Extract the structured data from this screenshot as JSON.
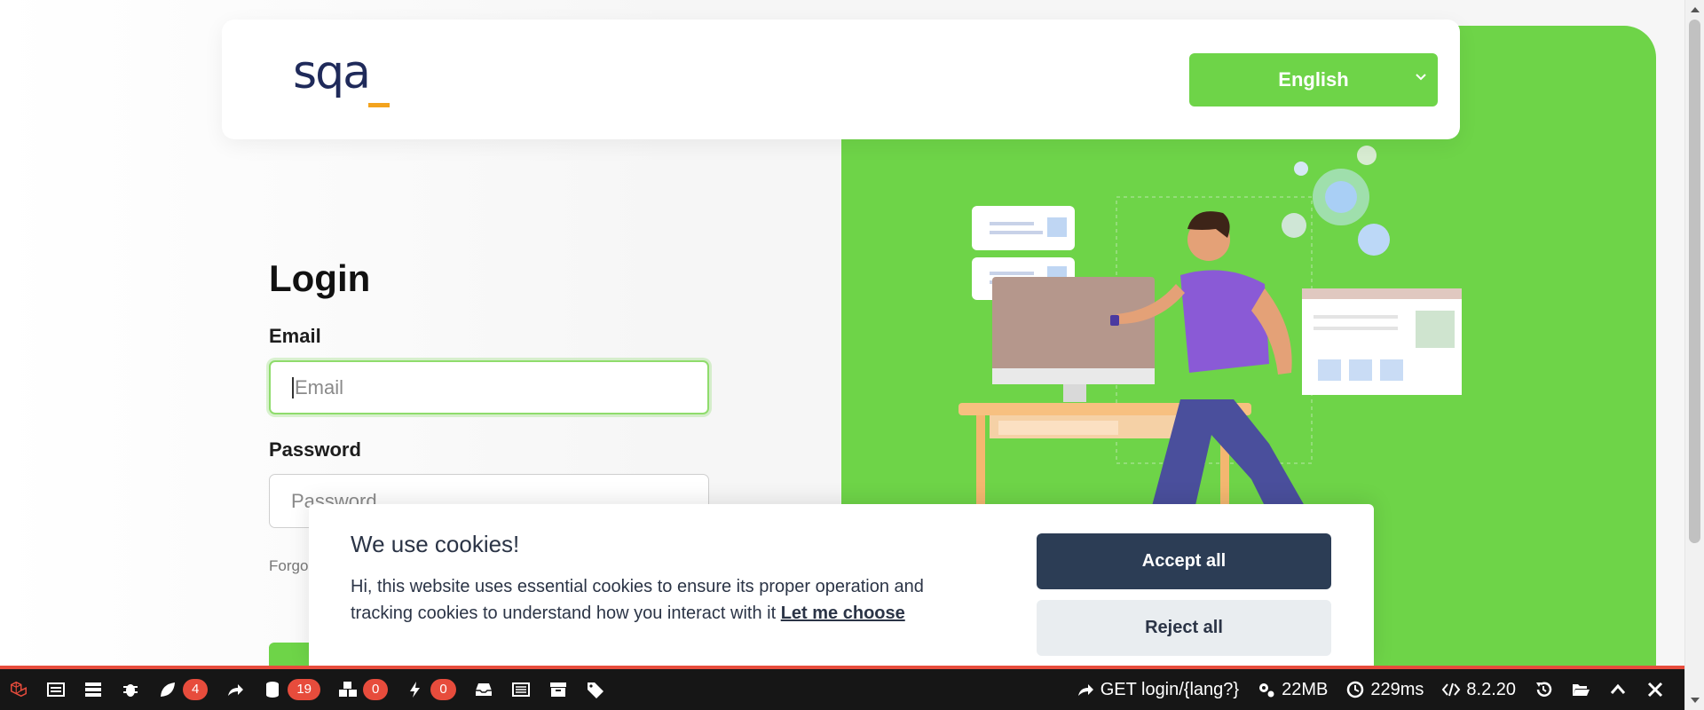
{
  "header": {
    "logo_text": "sqa",
    "language": {
      "selected": "English"
    }
  },
  "login": {
    "title": "Login",
    "email_label": "Email",
    "email_placeholder": "Email",
    "password_label": "Password",
    "password_placeholder": "Password",
    "forgot_text": "Forgo"
  },
  "cookie_banner": {
    "title": "We use cookies!",
    "text": "Hi, this website uses essential cookies to ensure its proper operation and tracking cookies to understand how you interact with it",
    "link": "Let me choose",
    "accept_label": "Accept all",
    "reject_label": "Reject all"
  },
  "debugbar": {
    "messages_count": "4",
    "queries_count": "19",
    "models_count": "0",
    "events_count": "0",
    "route": "GET login/{lang?}",
    "memory": "22MB",
    "time": "229ms",
    "php_version": "8.2.20"
  },
  "colors": {
    "brand_green": "#6ed448",
    "logo_navy": "#1f2a5a",
    "logo_orange": "#f3a31e",
    "accept_button": "#2c3d55",
    "debug_badge": "#e74c3c"
  }
}
